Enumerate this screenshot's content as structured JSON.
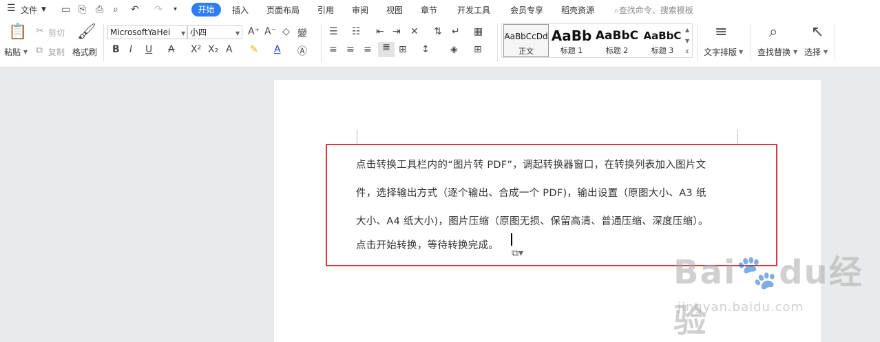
{
  "menu": {
    "hamburger_icon": "menu-icon",
    "file": "文件",
    "tabs": [
      "开始",
      "插入",
      "页面布局",
      "引用",
      "审阅",
      "视图",
      "章节",
      "开发工具",
      "会员专享",
      "稻壳资源"
    ],
    "search_placeholder": "查找命令、搜索模板",
    "accent": "#2e7cf6"
  },
  "ribbon": {
    "paste": "粘贴",
    "cut": "剪切",
    "copy": "复制",
    "format_painter": "格式刷",
    "font_name": "MicrosoftYaHei",
    "font_size": "小四",
    "styles": [
      {
        "preview": "AaBbCcDd",
        "name": "正文"
      },
      {
        "preview": "AaBb",
        "name": "标题 1"
      },
      {
        "preview": "AaBbC",
        "name": "标题 2"
      },
      {
        "preview": "AaBbC",
        "name": "标题 3"
      }
    ],
    "text_layout": "文字排版",
    "find_replace": "查找替换",
    "select": "选择"
  },
  "document": {
    "lines": [
      "点击转换工具栏内的“图片转 PDF”，调起转换器窗口，在转换列表加入图片文",
      "件，选择输出方式（逐个输出、合成一个 PDF)，输出设置（原图大小、A3 纸",
      "大小、A4 纸大小)，图片压缩（原图无损、保留高清、普通压缩、深度压缩）。",
      "点击开始转换，等待转换完成。"
    ],
    "highlight_color": "#d9363e"
  },
  "watermark": {
    "logo": "Baidu经验",
    "url": "jingyan.baidu.com"
  }
}
